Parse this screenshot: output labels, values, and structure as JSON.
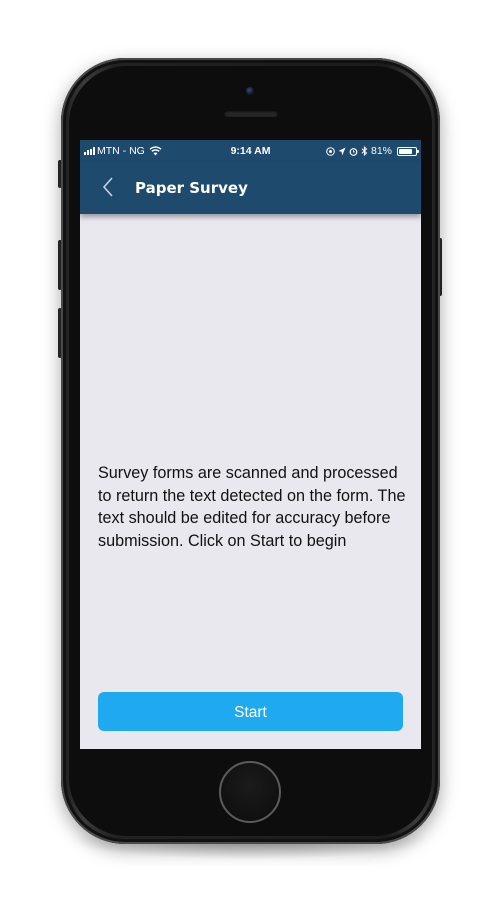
{
  "status_bar": {
    "carrier": "MTN - NG",
    "time": "9:14 AM",
    "battery_percent": "81%",
    "battery_level": 0.81,
    "icons": [
      "signal-bars-icon",
      "wifi-icon",
      "at-icon",
      "location-icon",
      "alarm-icon",
      "bluetooth-icon",
      "battery-icon"
    ]
  },
  "nav": {
    "back_icon": "chevron-left-icon",
    "title": "Paper Survey"
  },
  "main": {
    "description": "Survey forms are scanned and processed to return the text detected on the form. The text should be edited for accuracy before submission. Click on Start to begin",
    "start_label": "Start"
  },
  "colors": {
    "navbar": "#1e4a6d",
    "background": "#eae8ef",
    "button": "#1faaf0"
  }
}
